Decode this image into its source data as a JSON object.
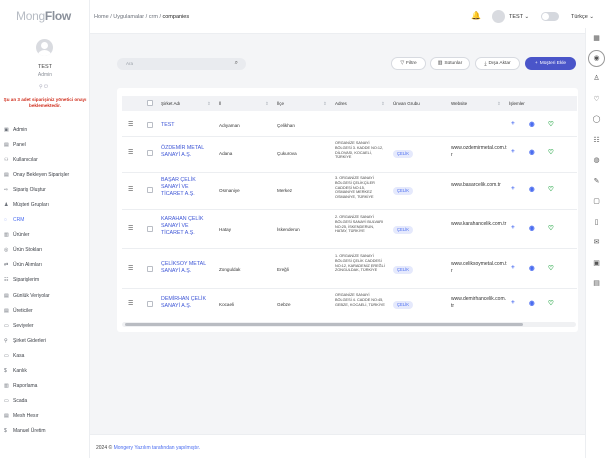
{
  "sidebar": {
    "logo_light": "Mong",
    "logo_bold": "Flow",
    "user_name": "TEST",
    "user_role": "Admin",
    "user_icons": "⚲ ⏻",
    "warning": "Şu an 3 adet siparişiniz yönetici onayı beklemektedir.",
    "items": [
      {
        "icon": "▣",
        "label": "Admin"
      },
      {
        "icon": "▤",
        "label": "Panel"
      },
      {
        "icon": "⚇",
        "label": "Kullanıcılar"
      },
      {
        "icon": "▤",
        "label": "Onay Bekleyen Siparişler"
      },
      {
        "icon": "⇨",
        "label": "Sipariş Oluştur"
      },
      {
        "icon": "♟",
        "label": "Müşteri Grupları"
      },
      {
        "icon": "◌",
        "label": "CRM"
      },
      {
        "icon": "▥",
        "label": "Ürünler"
      },
      {
        "icon": "◎",
        "label": "Ürün Stokları"
      },
      {
        "icon": "⇄",
        "label": "Ürün Alımları"
      },
      {
        "icon": "☷",
        "label": "Siparişlerim"
      },
      {
        "icon": "▤",
        "label": "Günlük Veriyolar"
      },
      {
        "icon": "▤",
        "label": "Üreticiler"
      },
      {
        "icon": "▭",
        "label": "Seviyeler"
      },
      {
        "icon": "⚲",
        "label": "Şirket Giderleri"
      },
      {
        "icon": "▭",
        "label": "Kasa"
      },
      {
        "icon": "$",
        "label": "Kanlık"
      },
      {
        "icon": "▥",
        "label": "Raporlama"
      },
      {
        "icon": "▭",
        "label": "Scada"
      },
      {
        "icon": "▤",
        "label": "Mesh Hesır"
      },
      {
        "icon": "$",
        "label": "Manuel Üretim"
      }
    ]
  },
  "topbar": {
    "breadcrumb_home": "Home",
    "breadcrumb_sep1": "/",
    "breadcrumb_apps": "Uygulamalar",
    "breadcrumb_sep2": "/",
    "breadcrumb_crm": "crm",
    "breadcrumb_sep3": "/",
    "breadcrumb_current": "companies",
    "bell_icon": "🔔",
    "user_label": "TEST ⌄",
    "language": "Türkçe ⌄"
  },
  "rail_icons": [
    "▦",
    "◉",
    "♙",
    "♡",
    "◯",
    "☷",
    "◍",
    "✎",
    "▢",
    "▯",
    "✉",
    "▣",
    "▤"
  ],
  "toolbar": {
    "search_placeholder": "Ara",
    "search_icon": "⌕",
    "filter_icon": "▽",
    "filter_label": "Filtre",
    "columns_icon": "▥",
    "columns_label": "Sütunlar",
    "export_icon": "⤓",
    "export_label": "Dışa Aktar",
    "add_icon": "+",
    "add_label": "Müşteri Ekle"
  },
  "table": {
    "columns": [
      "Şirket Adı",
      "İl",
      "İlçe",
      "Adres",
      "Ünvan Grubu",
      "Website",
      "İşlemler"
    ],
    "rows": [
      {
        "name": "TEST",
        "city": "Adıyaman",
        "district": "Çelikhan",
        "address": "",
        "group": "",
        "website": ""
      },
      {
        "name": "ÖZDEMİR METAL SANAYİ A.Ş.",
        "city": "Adana",
        "district": "Çukurova",
        "address": "ORGANİZE SANAYİ BÖLGESİ 3. KADDE NO:12, DİLOVASI, KOCAELİ, TÜRKİYE",
        "group": "ÇELİK",
        "website": "www.ozdemirmetal.com.tr"
      },
      {
        "name": "BAŞAR ÇELİK SANAYİ VE TİCARET A.Ş.",
        "city": "Osmaniye",
        "district": "Merkez",
        "address": "3. ORGANİZE SANAYİ BÖLGESİ ÇELİKÇİLER CADDESİ NO:15, OSMANİYE MERKEZ OSMANİYE, TÜRKİYE",
        "group": "ÇELİK",
        "website": "www.basarcelik.com.tr"
      },
      {
        "name": "KARAHAN ÇELİK SANAYİ VE TİCARET A.Ş.",
        "city": "Hatay",
        "district": "İskenderun",
        "address": "2. ORGANİZE SANAYİ BÖLGESİ SANAYİ BULVARI NO:25, İSKENDERUN, HATAY, TÜRKİYE",
        "group": "ÇELİK",
        "website": "www.karahancelik.com.tr"
      },
      {
        "name": "ÇELİKSOY METAL SANAYİ A.Ş.",
        "city": "Zonguldak",
        "district": "Ereğli",
        "address": "1. ORGANİZE SANAYİ BÖLGESİ ÇELİK CADDESİ NO:12, KARADENİZ EREĞLİ ZONGULDAK, TÜRKİYE",
        "group": "ÇELİK",
        "website": "www.celiksoymetal.com.tr"
      },
      {
        "name": "DEMİRHAN ÇELİK SANAYİ A.Ş.",
        "city": "Kocaeli",
        "district": "Gebze",
        "address": "ORGANİZE SANAYİ BÖLGESİ 4. CADDE NO:45, GEBZE, KOCAELİ, TÜRKİYE",
        "group": "ÇELİK",
        "website": "www.demirhancelik.com.tr"
      }
    ],
    "drag_icon": "☰",
    "add_action_icon": "+",
    "view_action_icon": "◉",
    "fav_action_icon": "♡",
    "sort_icon": "⇕"
  },
  "footer": {
    "prefix": "2024 ©",
    "link": "Mongery Yazılım tarafından yapılmıştır."
  },
  "colors": {
    "accent": "#4a6cf0",
    "primary_button": "#4a55c9",
    "fav": "#2aa84a",
    "warning": "#d0301f"
  }
}
